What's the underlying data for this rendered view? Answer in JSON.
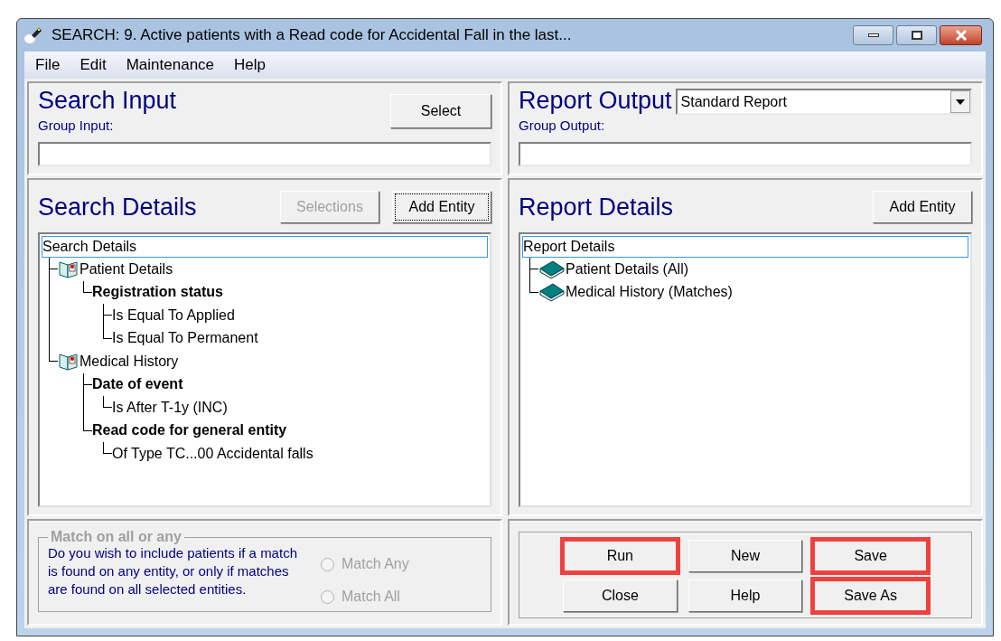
{
  "window": {
    "title": "SEARCH: 9. Active patients with a Read code for Accidental Fall in the last..."
  },
  "menu": [
    "File",
    "Edit",
    "Maintenance",
    "Help"
  ],
  "search_input": {
    "heading": "Search Input",
    "select_button": "Select",
    "group_label": "Group Input:"
  },
  "report_output": {
    "heading": "Report Output",
    "format": "Standard Report",
    "group_label": "Group Output:"
  },
  "search_details": {
    "heading": "Search Details",
    "buttons": [
      {
        "label": "Selections",
        "disabled": true,
        "focused": false
      },
      {
        "label": "Add Entity",
        "disabled": false,
        "focused": true
      }
    ],
    "tree": {
      "label": "Search Details",
      "selected": true,
      "children": [
        {
          "label": "Patient Details",
          "kind": "entity",
          "children": [
            {
              "label": "Registration status",
              "kind": "field",
              "children": [
                {
                  "label": "Is Equal To Applied",
                  "kind": "condition"
                },
                {
                  "label": "Is Equal To Permanent",
                  "kind": "condition"
                }
              ]
            }
          ]
        },
        {
          "label": "Medical History",
          "kind": "entity",
          "children": [
            {
              "label": "Date of event",
              "kind": "field",
              "children": [
                {
                  "label": "Is After T-1y (INC)",
                  "kind": "condition"
                }
              ]
            },
            {
              "label": "Read code for general entity",
              "kind": "field",
              "children": [
                {
                  "label": "Of Type TC...00 Accidental falls",
                  "kind": "condition"
                }
              ]
            }
          ]
        }
      ]
    }
  },
  "report_details": {
    "heading": "Report Details",
    "buttons": [
      {
        "label": "Add Entity",
        "disabled": false,
        "focused": false
      }
    ],
    "tree": {
      "label": "Report Details",
      "selected": true,
      "children": [
        {
          "label": "Patient Details (All)",
          "kind": "report-entity"
        },
        {
          "label": "Medical History (Matches)",
          "kind": "report-entity"
        }
      ]
    }
  },
  "match": {
    "legend": "Match on all or any",
    "disabled": true,
    "question": "Do you wish to include patients if a match is found on any entity, or only if matches are found on all selected entities.",
    "options": [
      {
        "label": "Match Any",
        "selected": false
      },
      {
        "label": "Match All",
        "selected": false
      }
    ]
  },
  "actions": [
    {
      "label": "Run",
      "highlighted": true
    },
    {
      "label": "New",
      "highlighted": false
    },
    {
      "label": "Save",
      "highlighted": true
    },
    {
      "label": "Close",
      "highlighted": false
    },
    {
      "label": "Help",
      "highlighted": false
    },
    {
      "label": "Save As",
      "highlighted": true
    }
  ]
}
